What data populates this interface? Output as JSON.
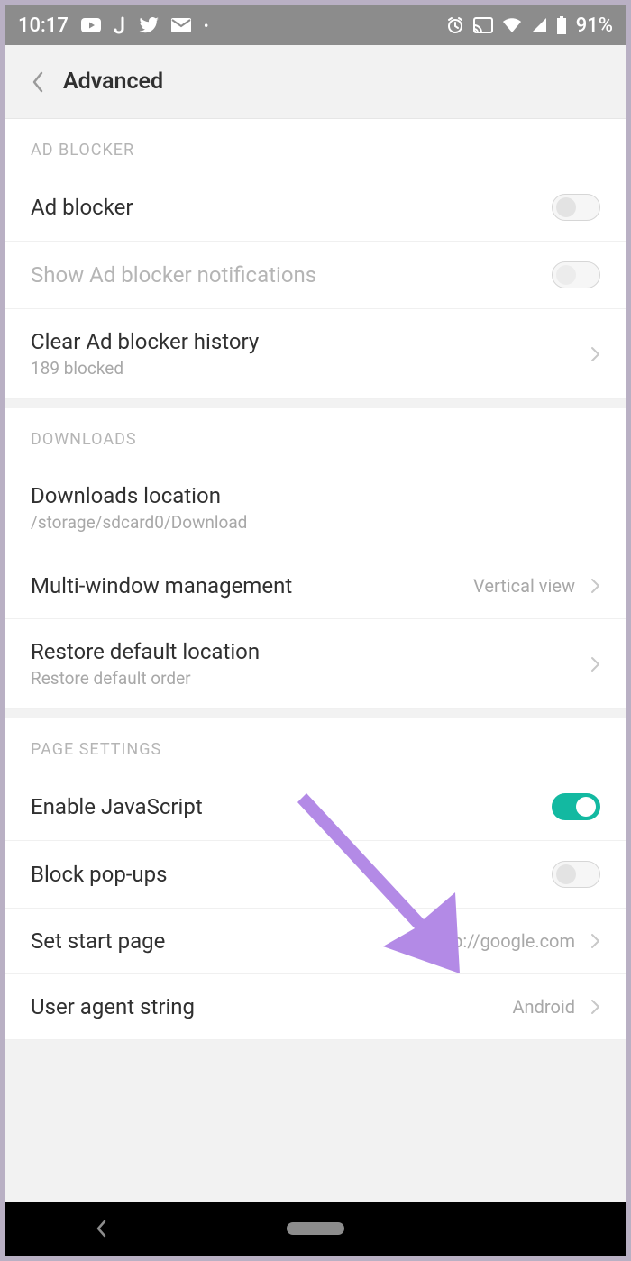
{
  "statusbar": {
    "time": "10:17",
    "battery_pct": "91%"
  },
  "appbar": {
    "title": "Advanced"
  },
  "sections": {
    "adblocker": {
      "header": "AD BLOCKER",
      "ad_blocker": {
        "title": "Ad blocker"
      },
      "show_notif": {
        "title": "Show Ad blocker notifications"
      },
      "clear_history": {
        "title": "Clear Ad blocker history",
        "subtitle": "189 blocked"
      }
    },
    "downloads": {
      "header": "DOWNLOADS",
      "location": {
        "title": "Downloads location",
        "subtitle": "/storage/sdcard0/Download"
      },
      "multiwindow": {
        "title": "Multi-window management",
        "value": "Vertical view"
      },
      "restore": {
        "title": "Restore default location",
        "subtitle": "Restore default order"
      }
    },
    "page": {
      "header": "PAGE SETTINGS",
      "js": {
        "title": "Enable JavaScript"
      },
      "popups": {
        "title": "Block pop-ups"
      },
      "start_page": {
        "title": "Set start page",
        "value": "http://google.com"
      },
      "ua": {
        "title": "User agent string",
        "value": "Android"
      }
    }
  }
}
